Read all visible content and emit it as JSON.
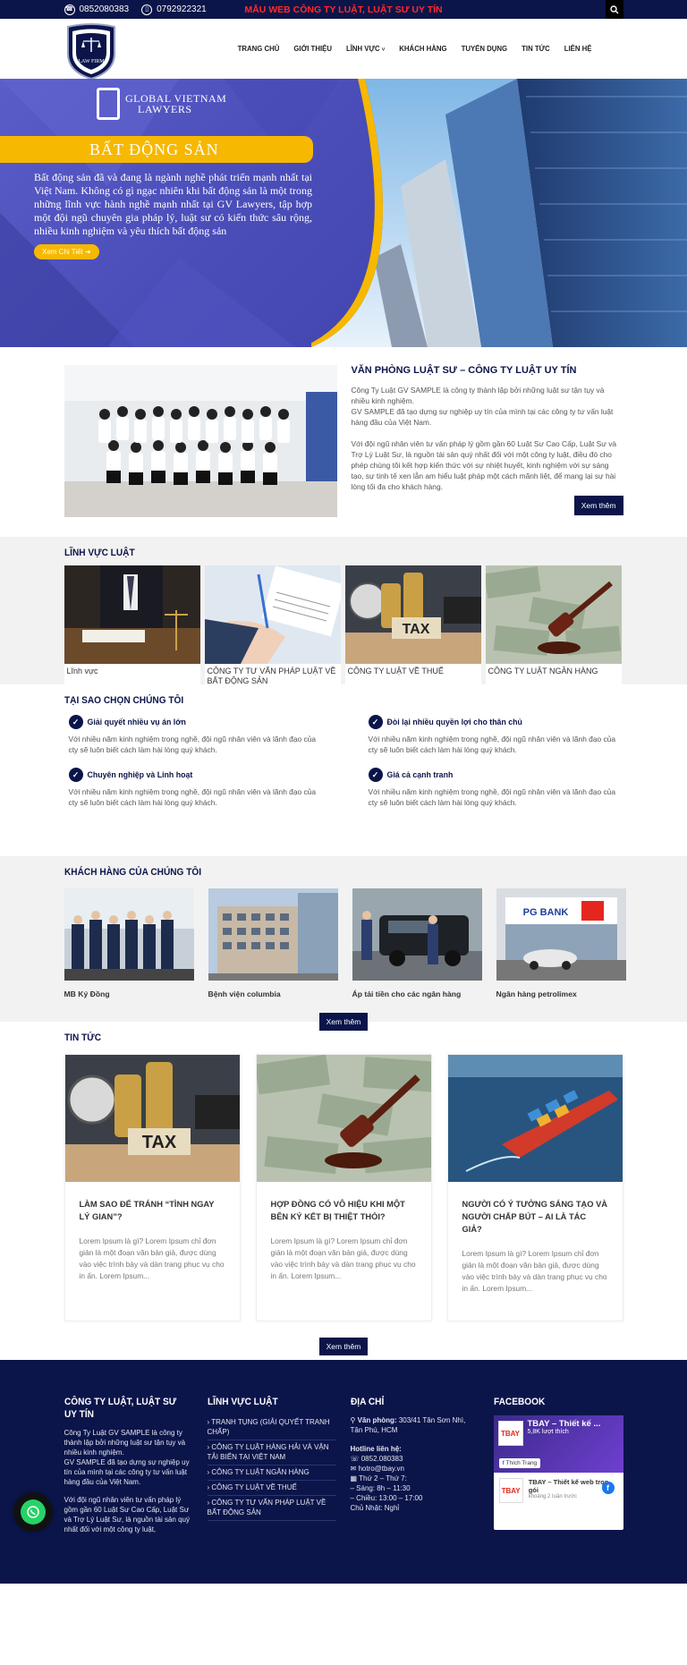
{
  "topbar": {
    "phone1": "0852080383",
    "phone2": "0792922321",
    "promo": "MẪU WEB CÔNG TY LUẬT, LUẬT SƯ UY TÍN"
  },
  "header": {
    "logo_text": "LAW FIRM",
    "nav": [
      "TRANG CHỦ",
      "GIỚI THIỆU",
      "LĨNH VỰC",
      "KHÁCH HÀNG",
      "TUYỂN DỤNG",
      "TIN TỨC",
      "LIÊN HỆ"
    ]
  },
  "hero": {
    "brand_line1": "GLOBAL VIETNAM",
    "brand_line2": "LAWYERS",
    "banner": "BẤT ĐỘNG SẢN",
    "description": "Bất động sản đã và đang là ngành nghề phát triển mạnh nhất tại Việt Nam. Không có gì ngạc nhiên khi bất động sản là một trong những lĩnh vực hành nghề mạnh nhất tại GV Lawyers, tập hợp một đội ngũ chuyên gia pháp lý, luật sư có kiến thức sâu rộng, nhiều kinh nghiệm và yêu thích bất động sản",
    "cta": "Xem Chi Tiết ➔"
  },
  "about": {
    "title": "VĂN PHÒNG LUẬT SƯ – CÔNG TY LUẬT UY TÍN",
    "p1": "Công Ty Luật GV SAMPLE là công ty thành lập bởi những luật sư tận tụy và nhiều kinh nghiệm.",
    "p2": "GV SAMPLE đã tạo dựng sự nghiệp uy tín của mình tại các công ty tư vấn luật hàng đầu của Việt Nam.",
    "p3": "Với đội ngũ nhân viên tư vấn pháp lý gồm gần 60 Luật Sư Cao Cấp, Luật Sư và Trợ Lý Luật Sư, là nguồn tài sản quý nhất đối với một công ty luật, điều đó cho phép chúng tôi kết hợp kiến thức với sự nhiệt huyết, kinh nghiệm với sự sáng tạo, sự tinh tế xen lẫn am hiểu luật pháp một cách mãnh liệt, để mang lại sự hài lòng tối đa cho khách hàng.",
    "button": "Xem thêm"
  },
  "fields": {
    "title": "LĨNH VỰC LUẬT",
    "items": [
      {
        "label": "Lĩnh vực"
      },
      {
        "label": "CÔNG TY TƯ VẤN PHÁP LUẬT VỀ BẤT ĐỘNG SẢN"
      },
      {
        "label": "CÔNG TY LUẬT VỀ THUẾ"
      },
      {
        "label": "CÔNG TY LUẬT NGÂN HÀNG"
      }
    ]
  },
  "why": {
    "title": "TẠI SAO CHỌN CHÚNG TÔI",
    "items": [
      {
        "title": "Giải quyết nhiều vụ án lớn",
        "text": "Với nhiều năm kinh nghiệm trong nghề, đội ngũ nhân viên và lãnh đạo của cty sẽ luôn biết cách làm hài lòng quý khách."
      },
      {
        "title": "Đòi lại nhiều quyền lợi cho thân chủ",
        "text": "Với nhiều năm kinh nghiệm trong nghề, đội ngũ nhân viên và lãnh đạo của cty sẽ luôn biết cách làm hài lòng quý khách."
      },
      {
        "title": "Chuyên nghiệp và Linh hoạt",
        "text": "Với nhiều năm kinh nghiệm trong nghề, đội ngũ nhân viên và lãnh đạo của cty sẽ luôn biết cách làm hài lòng quý khách."
      },
      {
        "title": "Giá cả cạnh tranh",
        "text": "Với nhiều năm kinh nghiệm trong nghề, đội ngũ nhân viên và lãnh đạo của cty sẽ luôn biết cách làm hài lòng quý khách."
      }
    ]
  },
  "clients": {
    "title": "KHÁCH HÀNG CỦA CHÚNG TÔI",
    "items": [
      {
        "label": "MB Ký Đồng"
      },
      {
        "label": "Bệnh viện columbia"
      },
      {
        "label": "Áp tải tiền cho các ngân hàng"
      },
      {
        "label": "Ngân hàng petrolimex",
        "sign": "PG BANK"
      }
    ],
    "button": "Xem thêm"
  },
  "news": {
    "title": "TIN TỨC",
    "items": [
      {
        "title": "LÀM SAO ĐỂ TRÁNH “TÌNH NGAY LÝ GIAN”?",
        "excerpt": "Lorem Ipsum là gì? Lorem Ipsum chỉ đơn giản là một đoạn văn bản giả, được dùng vào việc trình bày và dàn trang phục vụ cho in ấn. Lorem Ipsum..."
      },
      {
        "title": "HỢP ĐỒNG CÓ VÔ HIỆU KHI MỘT BÊN KÝ KẾT BỊ THIỆT THÒI?",
        "excerpt": "Lorem Ipsum là gì? Lorem Ipsum chỉ đơn giản là một đoạn văn bản giả, được dùng vào việc trình bày và dàn trang phục vụ cho in ấn. Lorem Ipsum..."
      },
      {
        "title": "NGƯỜI CÓ Ý TƯỞNG SÁNG TẠO VÀ NGƯỜI CHẤP BÚT – AI LÀ TÁC GIẢ?",
        "excerpt": "Lorem Ipsum là gì? Lorem Ipsum chỉ đơn giản là một đoạn văn bản giả, được dùng vào việc trình bày và dàn trang phục vụ cho in ấn. Lorem Ipsum..."
      }
    ],
    "tax_word": "TAX",
    "button": "Xem thêm"
  },
  "footer": {
    "col1": {
      "title": "CÔNG TY LUẬT, LUẬT SƯ UY TÍN",
      "p1": "Công Ty Luật GV SAMPLE là công ty thành lập bởi những luật sư tận tụy và nhiều kinh nghiệm.",
      "p2": "GV SAMPLE đã tạo dựng sự nghiệp uy tín của mình tại các công ty tư vấn luật hàng đầu của Việt Nam.",
      "p3": "Với đội ngũ nhân viên tư vấn pháp lý gồm gần 60 Luật Sư Cao Cấp, Luật Sư và Trợ Lý Luật Sư, là nguồn tài sản quý nhất đối với một công ty luật,"
    },
    "col2": {
      "title": "LĨNH VỰC LUẬT",
      "links": [
        "› TRANH TỤNG (GIẢI QUYẾT TRANH CHẤP)",
        "› CÔNG TY LUẬT HÀNG HẢI VÀ VẬN TẢI BIỂN TẠI VIỆT NAM",
        "› CÔNG TY LUẬT NGÂN HÀNG",
        "› CÔNG TY LUẬT VỀ THUẾ",
        "› CÔNG TY TƯ VẤN PHÁP LUẬT VỀ BẤT ĐỘNG SẢN"
      ]
    },
    "col3": {
      "title": "ĐỊA CHỈ",
      "office_label": "Văn phòng:",
      "office": "303/41 Tân Sơn Nhì, Tân Phú, HCM",
      "hotline_label": "Hotline liên hệ:",
      "phone": "0852.080383",
      "email": "hotro@tbay.vn",
      "days": "Thứ 2 – Thứ 7:",
      "morning": "– Sáng: 8h – 11:30",
      "afternoon": "– Chiều: 13:00 – 17:00",
      "sunday": "Chủ Nhật: Nghỉ"
    },
    "col4": {
      "title": "FACEBOOK",
      "page_name": "TBAY – Thiết kế ...",
      "likes": "5,8K lượt thích",
      "like_btn": "Thích Trang",
      "logo": "TBAY",
      "post_title": "TBAY – Thiết kế web trọn gói",
      "post_time": "khoảng 2 tuần trước"
    }
  }
}
